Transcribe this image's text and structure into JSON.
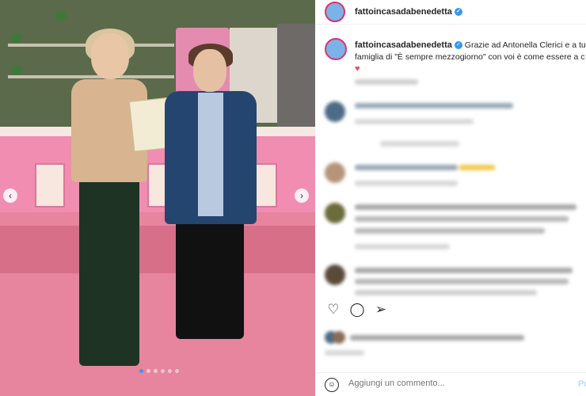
{
  "post": {
    "username": "fattoincasadabenedetta",
    "caption_line1": "Grazie ad Antonella Clerici e a tut",
    "caption_line2": "famiglia di \"È sempre mezzogiorno\" con voi è come essere a c",
    "caption_heart": "♥"
  },
  "photo": {
    "prev_icon": "‹",
    "next_icon": "›",
    "slides": 6,
    "active_slide": 1
  },
  "comments": [
    {
      "user": "",
      "text": ""
    },
    {
      "user": "",
      "text": ""
    },
    {
      "user": "",
      "text": ""
    },
    {
      "user": "",
      "text": ""
    }
  ],
  "actions": {
    "like_icon": "heart-outline-icon",
    "comment_icon": "comment-icon",
    "share_icon": "share-icon"
  },
  "composer": {
    "placeholder": "Aggiungi un commento...",
    "post_label": "Pu"
  },
  "colors": {
    "verified": "#3897f0",
    "like_heart": "#ed4956",
    "post_button": "#b2dffc"
  }
}
